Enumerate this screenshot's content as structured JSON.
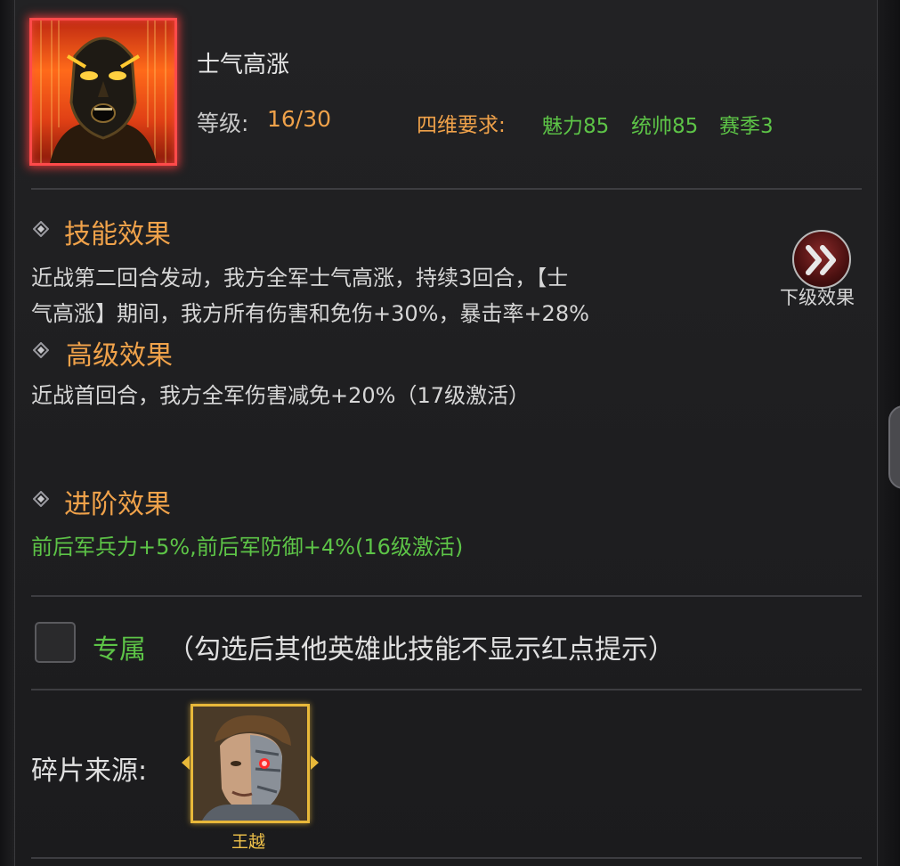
{
  "skill": {
    "name": "士气高涨",
    "portrait_icon": "screaming-face-icon",
    "level_label": "等级:",
    "level_value": "16/30",
    "requirements_label": "四维要求:",
    "requirements": [
      "魅力85",
      "统帅85",
      "赛季3"
    ]
  },
  "sections": {
    "effect": {
      "title": "技能效果",
      "lines": [
        "近战第二回合发动，我方全军士气高涨，持续3回合，【士",
        "气高涨】期间，我方所有伤害和免伤+30%，暴击率+28%"
      ]
    },
    "advanced": {
      "title": "高级效果",
      "lines": [
        "近战首回合，我方全军伤害减免+20%（17级激活）"
      ]
    },
    "promotion": {
      "title": "进阶效果",
      "lines": [
        "前后军兵力+5%,前后军防御+4%(16级激活)"
      ]
    }
  },
  "next_level": {
    "icon": "double-chevron-right-icon",
    "label": "下级效果"
  },
  "exclusive": {
    "checked": false,
    "label": "专属",
    "note": "（勾选后其他英雄此技能不显示红点提示）"
  },
  "source": {
    "label": "碎片来源:",
    "heroes": [
      {
        "name": "王越",
        "icon": "cyborg-hero-portrait"
      }
    ]
  },
  "colors": {
    "accent_orange": "#f0a24a",
    "accent_green": "#5dc447",
    "frame_red": "#ff4a4a",
    "frame_gold": "#e8b83a"
  }
}
